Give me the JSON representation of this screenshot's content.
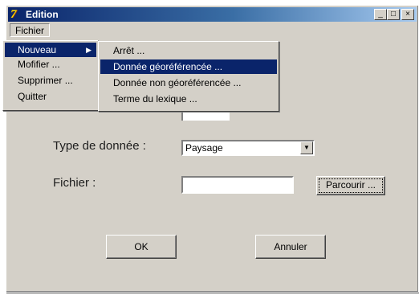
{
  "window": {
    "title": "Edition",
    "app_icon": "7e-app-icon",
    "controls": {
      "minimize": "_",
      "maximize": "□",
      "close": "×"
    }
  },
  "menubar": {
    "fichier": "Fichier"
  },
  "fichier_menu": {
    "items": [
      {
        "label": "Nouveau",
        "has_submenu": true,
        "selected": true
      },
      {
        "label": "Mofifier ..."
      },
      {
        "label": "Supprimer ..."
      },
      {
        "label": "Quitter"
      }
    ]
  },
  "nouveau_submenu": {
    "items": [
      {
        "label": "Arrêt ..."
      },
      {
        "label": "Donnée géoréférencée ...",
        "selected": true
      },
      {
        "label": "Donnée non géoréférencée ..."
      },
      {
        "label": "Terme du lexique ..."
      }
    ]
  },
  "form": {
    "type_label": "Type de donnée :",
    "type_value": "Paysage",
    "fichier_label": "Fichier :",
    "fichier_value": "",
    "browse_button": "Parcourir ..."
  },
  "buttons": {
    "ok": "OK",
    "cancel": "Annuler"
  },
  "colors": {
    "face": "#d4d0c8",
    "title_start": "#0a246a",
    "title_end": "#a6caf0",
    "highlight": "#0a246a"
  }
}
